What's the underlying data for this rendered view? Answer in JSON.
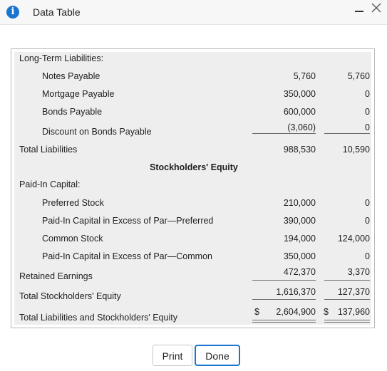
{
  "dialog": {
    "title": "Data Table",
    "info_icon": "info-icon",
    "info_glyph": "i",
    "minimize_icon": "minimize-icon",
    "close_icon": "close-icon"
  },
  "table": {
    "rows": [
      {
        "label": "Long-Term Liabilities:",
        "indent": 0,
        "bold": false,
        "col1": "",
        "col2": ""
      },
      {
        "label": "Notes Payable",
        "indent": 1,
        "bold": false,
        "col1": "5,760",
        "col2": "5,760"
      },
      {
        "label": "Mortgage Payable",
        "indent": 1,
        "bold": false,
        "col1": "350,000",
        "col2": "0"
      },
      {
        "label": "Bonds Payable",
        "indent": 1,
        "bold": false,
        "col1": "600,000",
        "col2": "0"
      },
      {
        "label": "Discount on Bonds Payable",
        "indent": 1,
        "bold": false,
        "col1": "(3,060)",
        "col2": "0"
      },
      {
        "label": "Total Liabilities",
        "indent": 0,
        "bold": false,
        "col1": "988,530",
        "col2": "10,590"
      },
      {
        "label": "Stockholders' Equity",
        "indent": 0,
        "bold": true,
        "col1": "",
        "col2": ""
      },
      {
        "label": "Paid-In Capital:",
        "indent": 0,
        "bold": false,
        "col1": "",
        "col2": ""
      },
      {
        "label": "Preferred Stock",
        "indent": 1,
        "bold": false,
        "col1": "210,000",
        "col2": "0"
      },
      {
        "label": "Paid-In Capital in Excess of Par—Preferred",
        "indent": 1,
        "bold": false,
        "col1": "390,000",
        "col2": "0"
      },
      {
        "label": "Common Stock",
        "indent": 1,
        "bold": false,
        "col1": "194,000",
        "col2": "124,000"
      },
      {
        "label": "Paid-In Capital in Excess of Par—Common",
        "indent": 1,
        "bold": false,
        "col1": "350,000",
        "col2": "0"
      },
      {
        "label": "Retained Earnings",
        "indent": 0,
        "bold": false,
        "col1": "472,370",
        "col2": "3,370"
      },
      {
        "label": "Total Stockholders' Equity",
        "indent": 0,
        "bold": false,
        "col1": "1,616,370",
        "col2": "127,370"
      },
      {
        "label": "Total Liabilities and Stockholders' Equity",
        "indent": 0,
        "bold": false,
        "col1": "2,604,900",
        "col2": "137,960",
        "col1_prefix": "$",
        "col2_prefix": "$"
      }
    ]
  },
  "buttons": {
    "print_label": "Print",
    "done_label": "Done"
  }
}
